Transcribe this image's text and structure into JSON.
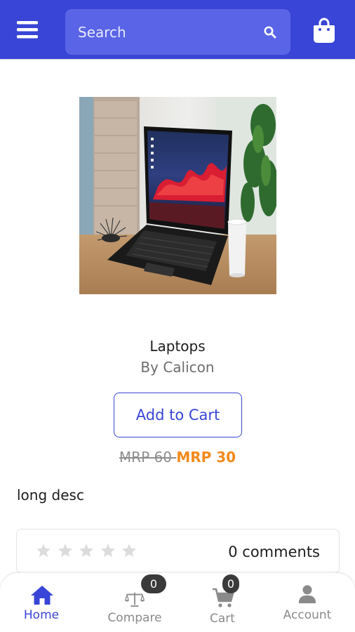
{
  "header": {
    "search_placeholder": "Search",
    "icons": {
      "menu": "hamburger-menu-icon",
      "search": "search-icon",
      "bag": "shopping-bag-icon"
    },
    "colors": {
      "bar": "#3845d6",
      "search_box": "#5a64e6"
    }
  },
  "product": {
    "image_alt": "Laptop",
    "title": "Laptops",
    "brand": "By Calicon",
    "add_to_cart_label": "Add to Cart",
    "mrp_original": "MRP 60 ",
    "mrp_sale": "MRP 30",
    "description": "long desc"
  },
  "reviews": {
    "rating": 0,
    "max_rating": 5,
    "comments_label": "0 comments"
  },
  "bottom_nav": {
    "items": [
      {
        "label": "Home",
        "icon": "home-icon",
        "active": true
      },
      {
        "label": "Compare",
        "icon": "scale-icon",
        "badge": "0",
        "active": false
      },
      {
        "label": "Cart",
        "icon": "cart-icon",
        "badge": "0",
        "active": false
      },
      {
        "label": "Account",
        "icon": "user-icon",
        "active": false
      }
    ]
  },
  "colors": {
    "accent": "#3845d6",
    "sale_price": "#f28a1c",
    "muted": "#8a8a8a",
    "badge": "#3a3a3a"
  }
}
